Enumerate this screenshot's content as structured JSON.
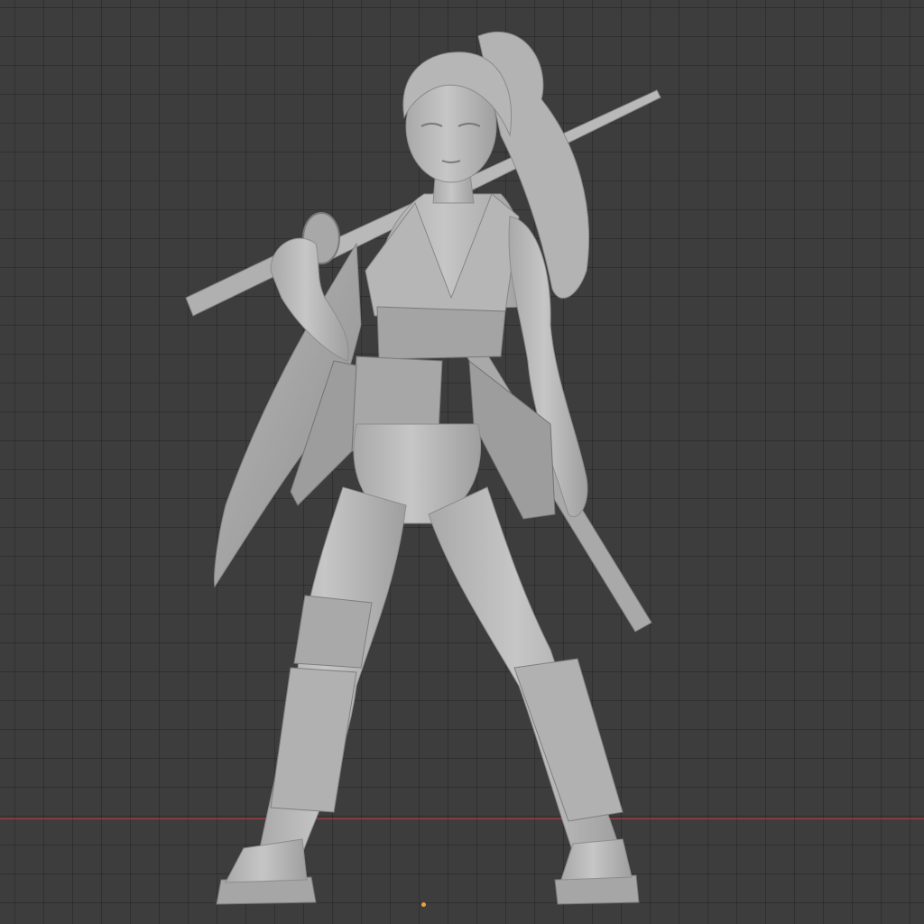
{
  "viewport": {
    "background_color": "#3d3d3d",
    "grid_color": "#333333",
    "x_axis_color": "#b43c46",
    "origin_color": "#e8a33c"
  },
  "model": {
    "material_color": "#bdbdbd",
    "shade_color": "#9a9a9a",
    "dark_color": "#7e7e7e"
  }
}
